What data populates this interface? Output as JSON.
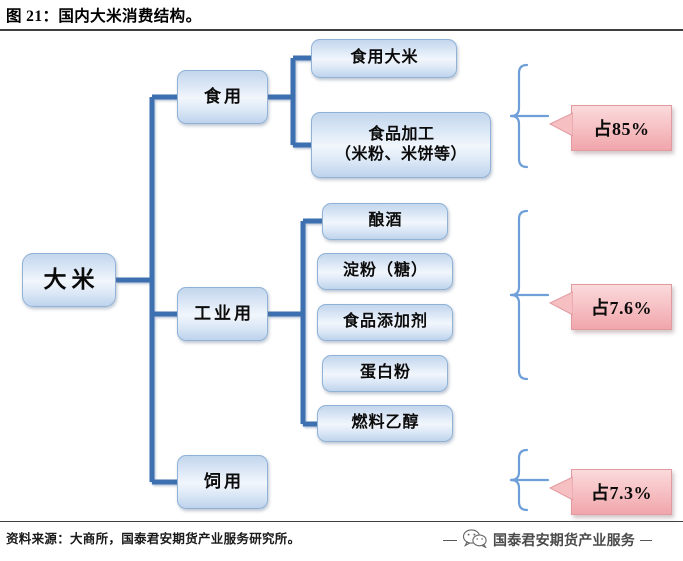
{
  "figure": {
    "title": "图 21：国内大米消费结构。",
    "source": "资料来源：大商所，国泰君安期货产业服务研究所。",
    "watermark": "国泰君安期货产业服务",
    "watermark_icon": "wechat-icon"
  },
  "colors": {
    "node_fill_top": "#c3d6ec",
    "node_fill_mid": "#f2f6fc",
    "node_fill_bottom": "#bed3ec",
    "node_border": "#8fb2d6",
    "connector": "#3d6fb0",
    "bracket": "#6f9fd8",
    "callout_fill_top": "#fadadc",
    "callout_fill_bottom": "#f0a6ab",
    "callout_border": "#e09aa0",
    "rule": "#3f3f3f"
  },
  "diagram": {
    "root": {
      "label": "大米"
    },
    "branches": [
      {
        "key": "food",
        "label": "食用",
        "percent_label": "占85%",
        "children": [
          {
            "label": "食用大米"
          },
          {
            "label": "食品加工\n（米粉、米饼等）"
          }
        ]
      },
      {
        "key": "industrial",
        "label": "工业用",
        "percent_label": "占7.6%",
        "children": [
          {
            "label": "酿酒"
          },
          {
            "label": "淀粉（糖）"
          },
          {
            "label": "食品添加剂"
          },
          {
            "label": "蛋白粉"
          },
          {
            "label": "燃料乙醇"
          }
        ]
      },
      {
        "key": "feed",
        "label": "饲用",
        "percent_label": "占7.3%",
        "children": []
      }
    ]
  }
}
